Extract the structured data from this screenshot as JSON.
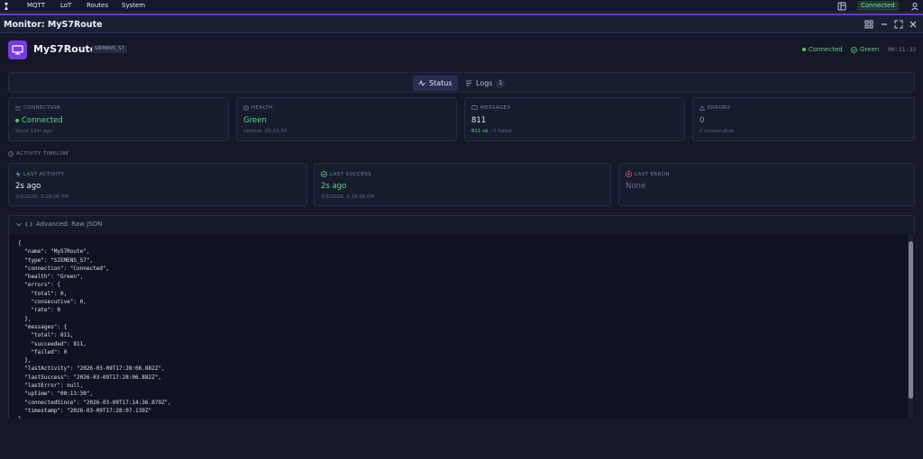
{
  "topnav": {
    "items": [
      "MQTT",
      "LoT",
      "Routes",
      "System"
    ],
    "connection_status": "Connected",
    "icons": [
      "logo-icon",
      "window-icon",
      "user-icon"
    ]
  },
  "monitor": {
    "title": "Monitor: MyS7Route",
    "window_buttons": [
      "grid-icon",
      "minimize-icon",
      "maximize-icon",
      "close-icon"
    ]
  },
  "route": {
    "name": "MyS7Route",
    "type": "SIEMENS_S7",
    "status_connection": "Connected",
    "status_health": "Green",
    "uptime": "00:11:32"
  },
  "tabs": {
    "status_label": "Status",
    "logs_label": "Logs",
    "logs_count": "1"
  },
  "cards": {
    "connection": {
      "label": "CONNECTION",
      "value": "Connected",
      "sub": "Since 13m ago"
    },
    "health": {
      "label": "HEALTH",
      "value": "Green",
      "sub": "Uptime: 00:13:30"
    },
    "messages": {
      "label": "MESSAGES",
      "value": "811",
      "sub_ok": "811 ok",
      "sub_rest": " / 0 failed"
    },
    "errors": {
      "label": "ERRORS",
      "value": "0",
      "sub": "0 consecutive"
    }
  },
  "timeline": {
    "section_label": "ACTIVITY TIMELINE",
    "last_activity": {
      "label": "LAST ACTIVITY",
      "value": "2s ago",
      "sub": "3/9/2026, 5:28:06 PM"
    },
    "last_success": {
      "label": "LAST SUCCESS",
      "value": "2s ago",
      "sub": "3/9/2026, 5:28:06 PM"
    },
    "last_error": {
      "label": "LAST ERROR",
      "value": "None"
    }
  },
  "advanced": {
    "label": "Advanced: Raw JSON",
    "json_text": "{\n  \"name\": \"MyS7Route\",\n  \"type\": \"SIEMENS_S7\",\n  \"connection\": \"Connected\",\n  \"health\": \"Green\",\n  \"errors\": {\n    \"total\": 0,\n    \"consecutive\": 0,\n    \"rate\": 0\n  },\n  \"messages\": {\n    \"total\": 811,\n    \"succeeded\": 811,\n    \"failed\": 0\n  },\n  \"lastActivity\": \"2026-03-09T17:28:06.882Z\",\n  \"lastSuccess\": \"2026-03-09T17:28:06.882Z\",\n  \"lastError\": null,\n  \"uptime\": \"00:13:30\",\n  \"connectedSince\": \"2026-03-09T17:14:36.879Z\",\n  \"timestamp\": \"2026-03-09T17:28:07.139Z\"\n}"
  },
  "colors": {
    "accent": "#6c3fbf",
    "route_icon_bg": "#7a3ce0",
    "success": "#5fd37f",
    "error": "#e05a5a"
  }
}
